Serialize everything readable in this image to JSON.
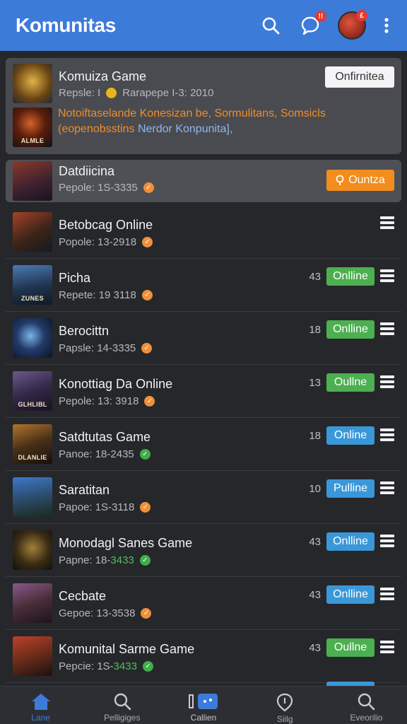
{
  "appbar": {
    "title": "Komunitas",
    "bell_badge": "!!",
    "avatar_badge": "£"
  },
  "featured": {
    "title": "Komuiza Game",
    "subtitle_a": "Repsle: I",
    "subtitle_b": "Rarapepe I-3: 2010",
    "button": "Onfirnitea",
    "notice_orange": "Notoiftaselande Konesizan be, Sormulitans, Somsicls (eopenobsstins",
    "notice_blue": "Nerdor Konpunita],",
    "thumb2_caption": "ALMLE"
  },
  "active": {
    "title": "Datdiicina",
    "subtitle": "Pepole: 1S-3335",
    "button": "Ountza"
  },
  "rows": [
    {
      "title": "Betobcag Online",
      "subtitle": "Popole: 13-2918",
      "count": "",
      "status": "",
      "dot": "orange",
      "thumb_caption": ""
    },
    {
      "title": "Picha",
      "subtitle": "Repete: 19  3118",
      "count": "43",
      "status": "Onlline",
      "dot": "orange",
      "thumb_caption": "ZUNES"
    },
    {
      "title": "Berocittn",
      "subtitle": "Papsle: 14-3335",
      "count": "18",
      "status": "Onlline",
      "dot": "orange",
      "thumb_caption": ""
    },
    {
      "title": "Konottiag Da Online",
      "subtitle": "Pepole: 13: 3918",
      "count": "13",
      "status": "Oullne",
      "dot": "orange",
      "thumb_caption": "GLHLIBL"
    },
    {
      "title": "Satdtutas Game",
      "subtitle": "Panoe: 18-2435",
      "count": "18",
      "status": "Online",
      "dot": "green",
      "thumb_caption": "DLANLIE"
    },
    {
      "title": "Saratitan",
      "subtitle": "Papoe: 1S-3118",
      "count": "10",
      "status": "Pulline",
      "dot": "orange",
      "thumb_caption": ""
    },
    {
      "title": "Monodagl Sanes Game",
      "subtitle_a": "Papne: 18-",
      "subtitle_b": "3433",
      "count": "43",
      "status": "Onlline",
      "dot": "green",
      "thumb_caption": ""
    },
    {
      "title": "Cecbate",
      "subtitle": "Gepoe: 13-3538",
      "count": "43",
      "status": "Onlline",
      "dot": "orange",
      "thumb_caption": ""
    },
    {
      "title": "Komunital Sarme Game",
      "subtitle_a": "Pepcie: 1S-",
      "subtitle_b": "3433",
      "count": "43",
      "status": "Oullne",
      "dot": "green",
      "thumb_caption": ""
    }
  ],
  "bottomnav": [
    {
      "label": "Lane",
      "icon": "home-icon"
    },
    {
      "label": "Pelligiges",
      "icon": "search-icon"
    },
    {
      "label": "Callien",
      "icon": "chat-icon"
    },
    {
      "label": "Siilg",
      "icon": "shield-icon"
    },
    {
      "label": "Eveorilio",
      "icon": "search-icon"
    }
  ],
  "colors": {
    "appbar": "#3d7bd9",
    "status_green": "#4caf50",
    "status_blue": "#3a97d8",
    "join_orange": "#f28d1e",
    "notice_orange": "#ef8c2c"
  }
}
